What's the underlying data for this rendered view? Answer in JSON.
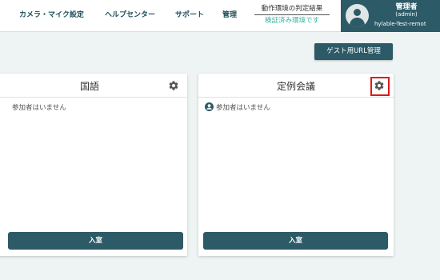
{
  "nav": {
    "camera_mic": "カメラ・マイク設定",
    "help": "ヘルプセンター",
    "support": "サポート",
    "admin": "管理"
  },
  "env": {
    "title": "動作環境の判定結果",
    "status": "検証済み環境です"
  },
  "user": {
    "name": "管理者",
    "role": "(admin)",
    "id": "hylable-Test-remot"
  },
  "guest_url_button": "ゲスト用URL管理",
  "rooms": [
    {
      "title": "国語",
      "empty_text": "参加者はいません",
      "enter_label": "入室"
    },
    {
      "title": "定例会議",
      "empty_text": "参加者はいません",
      "enter_label": "入室"
    }
  ],
  "colors": {
    "primary": "#2c5a66",
    "accent": "#3bb3a3",
    "highlight": "#e01818",
    "background": "#eef4f4"
  }
}
